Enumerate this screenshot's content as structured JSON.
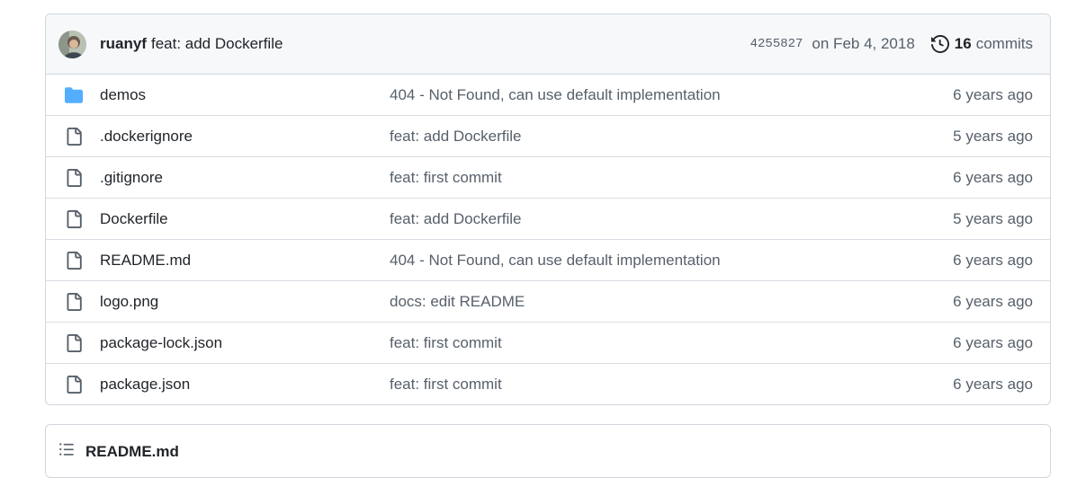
{
  "commit": {
    "author": "ruanyf",
    "message": "feat: add Dockerfile",
    "sha": "4255827",
    "date": "on Feb 4, 2018",
    "history_count": "16",
    "history_label": "commits"
  },
  "files": [
    {
      "name": "demos",
      "type": "folder",
      "message": "404 - Not Found, can use default implementation",
      "age": "6 years ago"
    },
    {
      "name": ".dockerignore",
      "type": "file",
      "message": "feat: add Dockerfile",
      "age": "5 years ago"
    },
    {
      "name": ".gitignore",
      "type": "file",
      "message": "feat: first commit",
      "age": "6 years ago"
    },
    {
      "name": "Dockerfile",
      "type": "file",
      "message": "feat: add Dockerfile",
      "age": "5 years ago"
    },
    {
      "name": "README.md",
      "type": "file",
      "message": "404 - Not Found, can use default implementation",
      "age": "6 years ago"
    },
    {
      "name": "logo.png",
      "type": "file",
      "message": "docs: edit README",
      "age": "6 years ago"
    },
    {
      "name": "package-lock.json",
      "type": "file",
      "message": "feat: first commit",
      "age": "6 years ago"
    },
    {
      "name": "package.json",
      "type": "file",
      "message": "feat: first commit",
      "age": "6 years ago"
    }
  ],
  "readme": {
    "title": "README.md"
  },
  "colors": {
    "folder": "#54aeff",
    "border": "#d0d7de",
    "muted": "#57606a"
  }
}
